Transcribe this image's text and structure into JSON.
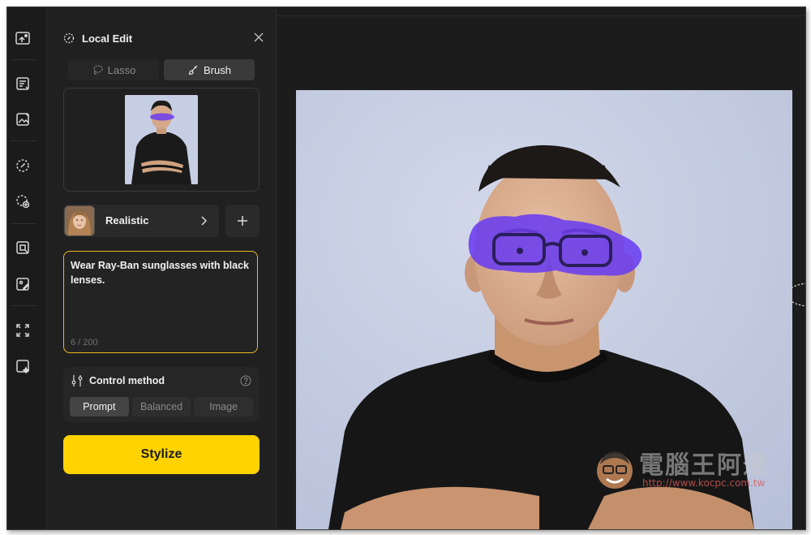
{
  "panel": {
    "title": "Local Edit",
    "modes": [
      "Lasso",
      "Brush"
    ],
    "active_mode": "Brush"
  },
  "style": {
    "label": "Realistic"
  },
  "prompt": {
    "text": "Wear Ray-Ban sunglasses with black lenses.",
    "count": "6 / 200"
  },
  "control": {
    "title": "Control method",
    "options": [
      "Prompt",
      "Balanced",
      "Image"
    ],
    "active": "Prompt"
  },
  "action": {
    "label": "Stylize"
  },
  "watermark": {
    "title": "電腦王阿達",
    "url": "http://www.kocpc.com.tw"
  },
  "icons": {
    "toolbar": [
      "upload-image-icon",
      "text-edit-icon",
      "image-edit-icon",
      "local-edit-icon",
      "add-selection-icon",
      "smart-crop-icon",
      "style-edit-icon",
      "expand-icon",
      "magic-frame-icon"
    ],
    "panel": [
      "lasso-icon",
      "brush-icon",
      "close-icon",
      "chevron-right-icon",
      "plus-icon",
      "sliders-icon",
      "help-icon"
    ]
  },
  "colors": {
    "accent": "#ffd200",
    "prompt_border": "#e8b923",
    "mask": "#6a3cf0"
  }
}
